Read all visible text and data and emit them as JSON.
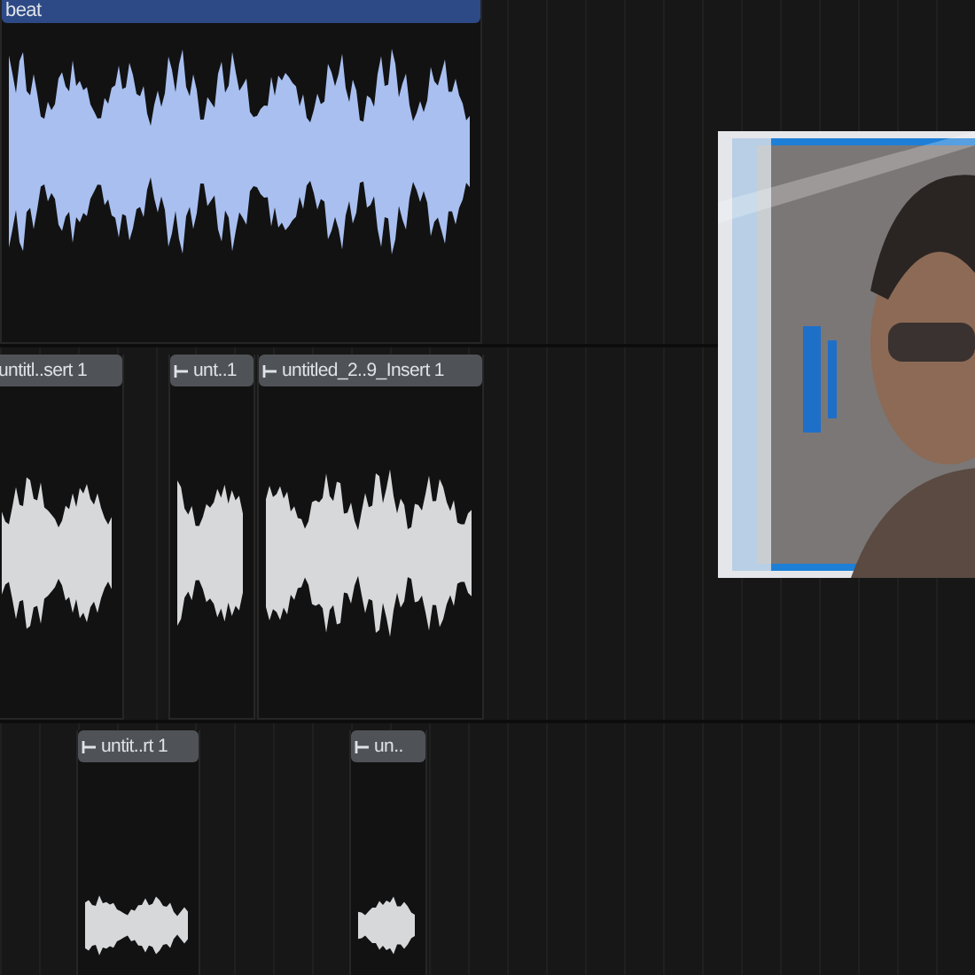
{
  "tracks": [
    {
      "clips": [
        {
          "label": "beat",
          "color": "#2e4a86"
        }
      ]
    },
    {
      "clips": [
        {
          "label": "untitl..sert 1",
          "color": "#4f5357"
        },
        {
          "label": "unt..1",
          "color": "#4f5357"
        },
        {
          "label": "untitled_2..9_Insert 1",
          "color": "#4f5357"
        }
      ]
    },
    {
      "clips": [
        {
          "label": "untit..rt 1",
          "color": "#4f5357"
        },
        {
          "label": "un..",
          "color": "#4f5357"
        }
      ]
    }
  ]
}
